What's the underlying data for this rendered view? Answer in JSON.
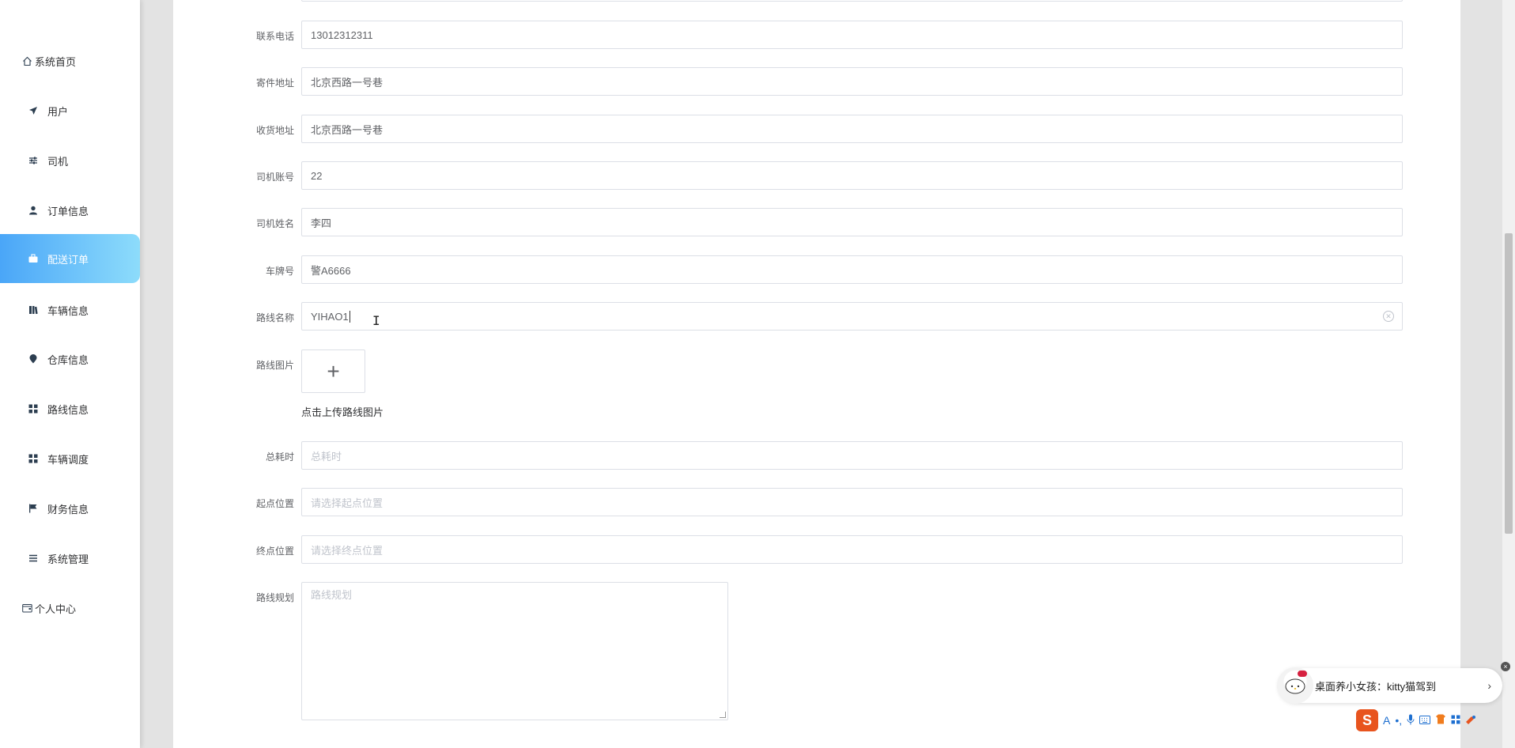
{
  "sidebar": {
    "items": [
      {
        "label": "系统首页",
        "icon": "home-icon"
      },
      {
        "label": "用户",
        "icon": "paper-plane-icon"
      },
      {
        "label": "司机",
        "icon": "sliders-icon"
      },
      {
        "label": "订单信息",
        "icon": "user-icon"
      },
      {
        "label": "配送订单",
        "icon": "briefcase-icon",
        "active": true
      },
      {
        "label": "车辆信息",
        "icon": "book-icon"
      },
      {
        "label": "仓库信息",
        "icon": "map-pin-icon"
      },
      {
        "label": "路线信息",
        "icon": "grid-icon"
      },
      {
        "label": "车辆调度",
        "icon": "grid-icon"
      },
      {
        "label": "财务信息",
        "icon": "flag-icon"
      },
      {
        "label": "系统管理",
        "icon": "list-icon"
      },
      {
        "label": "个人中心",
        "icon": "wallet-icon"
      }
    ]
  },
  "form": {
    "phone": {
      "label": "联系电话",
      "value": "13012312311"
    },
    "send_address": {
      "label": "寄件地址",
      "value": "北京西路一号巷"
    },
    "receive_address": {
      "label": "收货地址",
      "value": "北京西路一号巷"
    },
    "driver_account": {
      "label": "司机账号",
      "value": "22"
    },
    "driver_name": {
      "label": "司机姓名",
      "value": "李四"
    },
    "plate": {
      "label": "车牌号",
      "value": "警A6666"
    },
    "route_name": {
      "label": "路线名称",
      "value": "YIHAO1"
    },
    "route_image": {
      "label": "路线图片",
      "plus": "+",
      "hint": "点击上传路线图片"
    },
    "total_time": {
      "label": "总耗时",
      "placeholder": "总耗时"
    },
    "start": {
      "label": "起点位置",
      "placeholder": "请选择起点位置"
    },
    "end": {
      "label": "终点位置",
      "placeholder": "请选择终点位置"
    },
    "plan": {
      "label": "路线规划",
      "placeholder": "路线规划"
    }
  },
  "popup": {
    "text": "桌面养小女孩：kitty猫驾到",
    "arrow": "›",
    "close": "×"
  },
  "ime": {
    "logo": "S",
    "a": "A"
  }
}
